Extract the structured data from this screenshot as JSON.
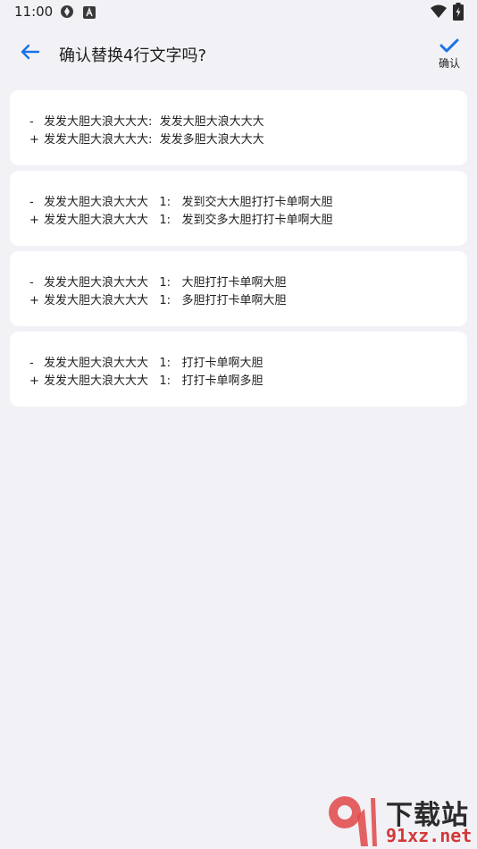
{
  "status_bar": {
    "time": "11:00",
    "icons": [
      "sync-icon",
      "keyboard-a-icon",
      "wifi-icon",
      "battery-charging-icon"
    ]
  },
  "app_bar": {
    "title": "确认替换4行文字吗?",
    "confirm_label": "确认",
    "back_icon": "arrow-left-icon",
    "confirm_icon": "check-icon",
    "accent_color": "#1a73e8"
  },
  "changes": [
    {
      "removed": {
        "sign": "-",
        "text": "发发大胆大浪大大大:  发发大胆大浪大大大"
      },
      "added": {
        "sign": "+",
        "text": "发发大胆大浪大大大:  发发多胆大浪大大大"
      }
    },
    {
      "removed": {
        "sign": "-",
        "text": "发发大胆大浪大大大   1:   发到交大大胆打打卡单啊大胆"
      },
      "added": {
        "sign": "+",
        "text": "发发大胆大浪大大大   1:   发到交多大胆打打卡单啊大胆"
      }
    },
    {
      "removed": {
        "sign": "-",
        "text": "发发大胆大浪大大大   1:   大胆打打卡单啊大胆"
      },
      "added": {
        "sign": "+",
        "text": "发发大胆大浪大大大   1:   多胆打打卡单啊大胆"
      }
    },
    {
      "removed": {
        "sign": "-",
        "text": "发发大胆大浪大大大   1:   打打卡单啊大胆"
      },
      "added": {
        "sign": "+",
        "text": "发发大胆大浪大大大   1:   打打卡单啊多胆"
      }
    }
  ],
  "watermark": {
    "brand": "下载站",
    "domain": "91xz.net"
  }
}
